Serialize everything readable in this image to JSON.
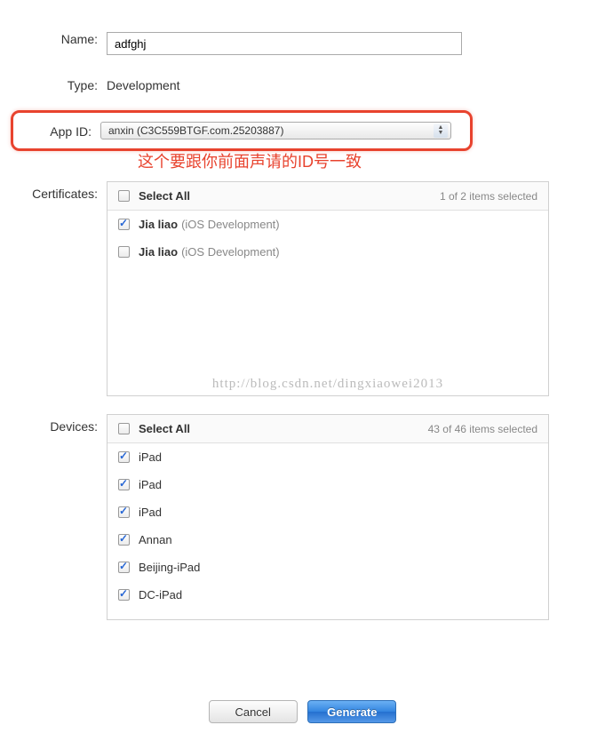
{
  "labels": {
    "name": "Name:",
    "type": "Type:",
    "appId": "App ID:",
    "certificates": "Certificates:",
    "devices": "Devices:",
    "selectAll": "Select All"
  },
  "form": {
    "nameValue": "adfghj",
    "typeValue": "Development",
    "appIdValue": "anxin (C3C559BTGF.com.25203887)"
  },
  "annotation": "这个要跟你前面声请的ID号一致",
  "certificates": {
    "selectionCount": "1 of 2 items selected",
    "items": [
      {
        "checked": true,
        "name": "Jia liao",
        "detail": "(iOS Development)"
      },
      {
        "checked": false,
        "name": "Jia liao",
        "detail": "(iOS Development)"
      }
    ]
  },
  "devices": {
    "selectionCount": "43 of 46 items selected",
    "items": [
      {
        "checked": true,
        "name": "iPad"
      },
      {
        "checked": true,
        "name": "iPad"
      },
      {
        "checked": true,
        "name": "iPad"
      },
      {
        "checked": true,
        "name": "Annan"
      },
      {
        "checked": true,
        "name": "Beijing-iPad"
      },
      {
        "checked": true,
        "name": "DC-iPad"
      }
    ]
  },
  "watermark": "http://blog.csdn.net/dingxiaowei2013",
  "buttons": {
    "cancel": "Cancel",
    "generate": "Generate"
  }
}
